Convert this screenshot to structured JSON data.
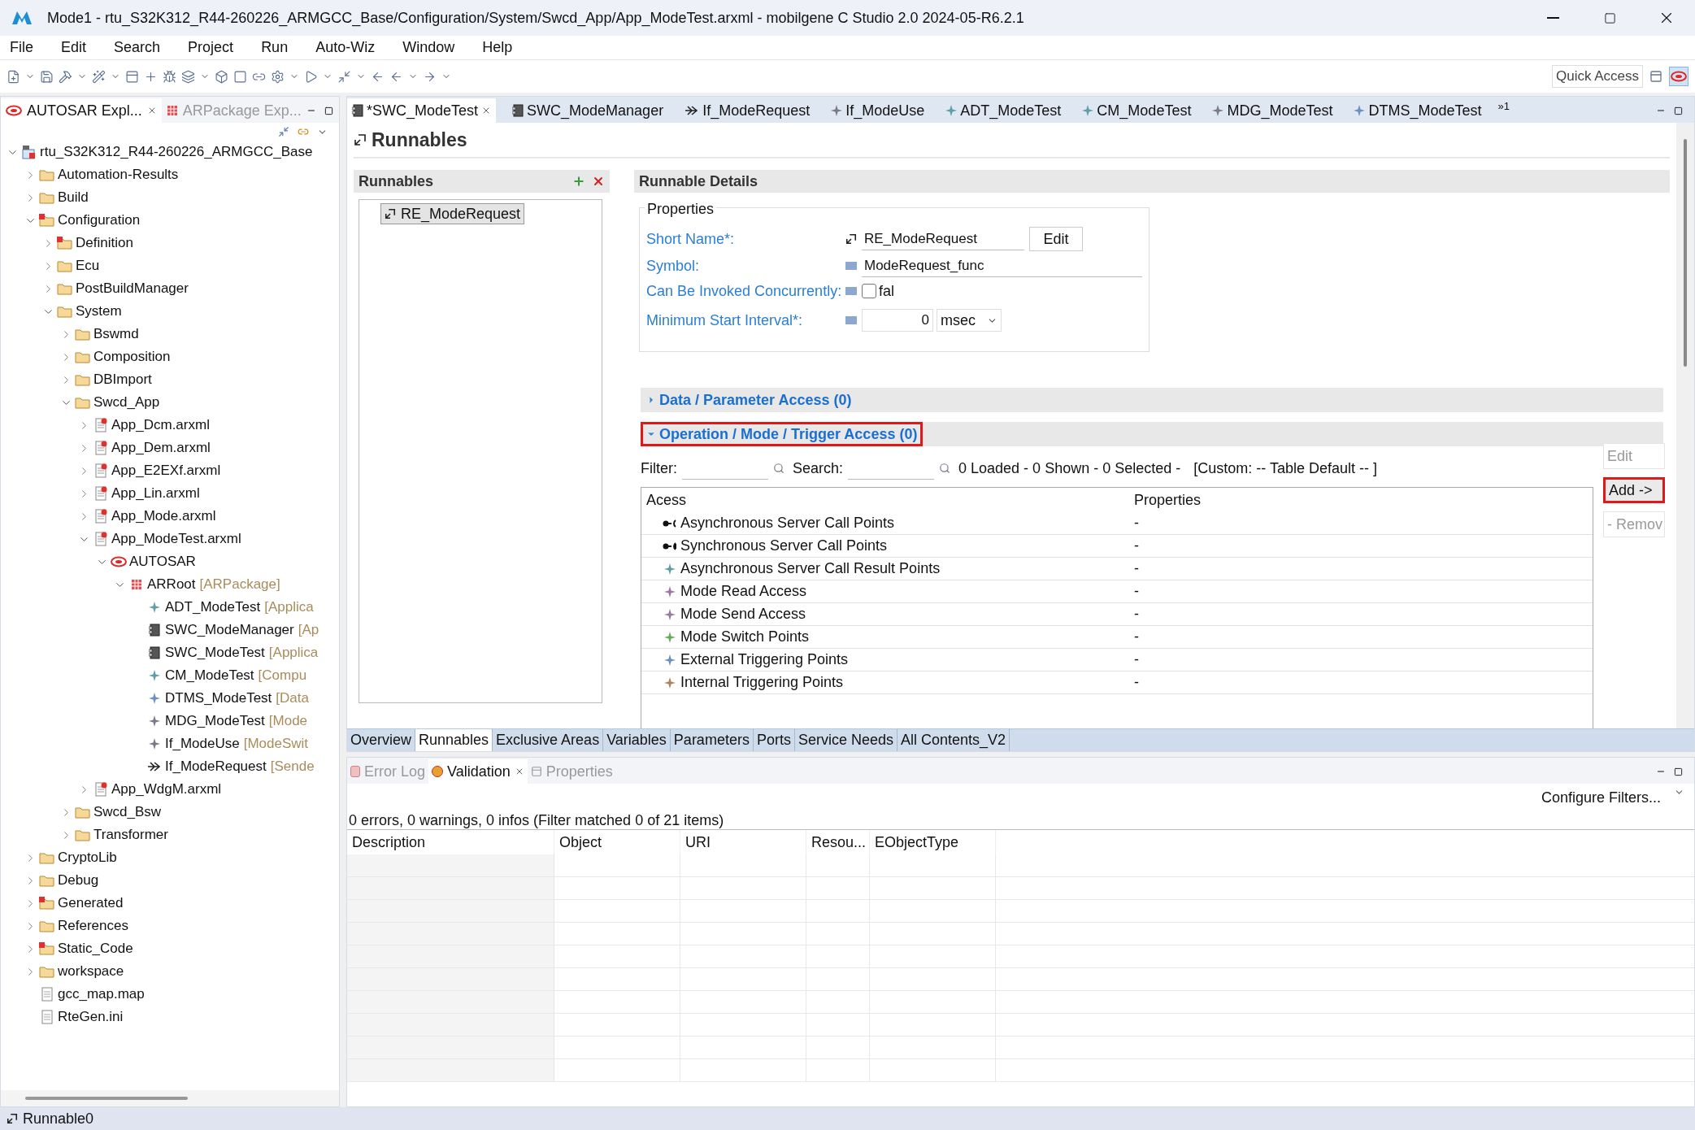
{
  "window": {
    "title": "Mode1 - rtu_S32K312_R44-260226_ARMGCC_Base/Configuration/System/Swcd_App/App_ModeTest.arxml - mobilgene C Studio 2.0 2024-05-R6.2.1"
  },
  "menu": [
    "File",
    "Edit",
    "Search",
    "Project",
    "Run",
    "Auto-Wiz",
    "Window",
    "Help"
  ],
  "quick_access": {
    "placeholder": "Quick Access"
  },
  "left_tabs": [
    {
      "label": "AUTOSAR Expl...",
      "selected": true
    },
    {
      "label": "ARPackage Exp...",
      "selected": false
    }
  ],
  "tree": [
    {
      "label": "rtu_S32K312_R44-260226_ARMGCC_Base",
      "kind": "project",
      "expanded": true,
      "children": [
        {
          "label": "Automation-Results",
          "kind": "folder",
          "expanded": false
        },
        {
          "label": "Build",
          "kind": "folder",
          "expanded": false
        },
        {
          "label": "Configuration",
          "kind": "errorfolder",
          "expanded": true,
          "children": [
            {
              "label": "Definition",
              "kind": "errorfolder",
              "expanded": false
            },
            {
              "label": "Ecu",
              "kind": "folder",
              "expanded": false
            },
            {
              "label": "PostBuildManager",
              "kind": "folder",
              "expanded": false
            },
            {
              "label": "System",
              "kind": "folder",
              "expanded": true,
              "children": [
                {
                  "label": "Bswmd",
                  "kind": "folder",
                  "expanded": false
                },
                {
                  "label": "Composition",
                  "kind": "folder",
                  "expanded": false
                },
                {
                  "label": "DBImport",
                  "kind": "folder",
                  "expanded": false
                },
                {
                  "label": "Swcd_App",
                  "kind": "folder",
                  "expanded": true,
                  "children": [
                    {
                      "label": "App_Dcm.arxml",
                      "kind": "file",
                      "expanded": false
                    },
                    {
                      "label": "App_Dem.arxml",
                      "kind": "file",
                      "expanded": false
                    },
                    {
                      "label": "App_E2EXf.arxml",
                      "kind": "file",
                      "expanded": false
                    },
                    {
                      "label": "App_Lin.arxml",
                      "kind": "file",
                      "expanded": false
                    },
                    {
                      "label": "App_Mode.arxml",
                      "kind": "file",
                      "expanded": false
                    },
                    {
                      "label": "App_ModeTest.arxml",
                      "kind": "file",
                      "expanded": true,
                      "children": [
                        {
                          "label": "AUTOSAR",
                          "kind": "autosar",
                          "expanded": true,
                          "children": [
                            {
                              "label": "ARRoot",
                              "suffix": "[ARPackage]",
                              "kind": "package",
                              "expanded": true,
                              "children": [
                                {
                                  "label": "ADT_ModeTest",
                                  "suffix": "[Applica",
                                  "kind": "teal"
                                },
                                {
                                  "label": "SWC_ModeManager",
                                  "suffix": "[Ap",
                                  "kind": "component"
                                },
                                {
                                  "label": "SWC_ModeTest",
                                  "suffix": "[Applica",
                                  "kind": "component"
                                },
                                {
                                  "label": "CM_ModeTest",
                                  "suffix": "[Compu",
                                  "kind": "teal"
                                },
                                {
                                  "label": "DTMS_ModeTest",
                                  "suffix": "[Data",
                                  "kind": "blue"
                                },
                                {
                                  "label": "MDG_ModeTest",
                                  "suffix": "[Mode",
                                  "kind": "gray"
                                },
                                {
                                  "label": "If_ModeUse",
                                  "suffix": "[ModeSwit",
                                  "kind": "gray"
                                },
                                {
                                  "label": "If_ModeRequest",
                                  "suffix": "[Sende",
                                  "kind": "interface"
                                }
                              ]
                            }
                          ]
                        }
                      ]
                    },
                    {
                      "label": "App_WdgM.arxml",
                      "kind": "file",
                      "expanded": false
                    }
                  ]
                },
                {
                  "label": "Swcd_Bsw",
                  "kind": "folder",
                  "expanded": false
                },
                {
                  "label": "Transformer",
                  "kind": "folder",
                  "expanded": false
                }
              ]
            }
          ]
        },
        {
          "label": "CryptoLib",
          "kind": "folder",
          "expanded": false
        },
        {
          "label": "Debug",
          "kind": "folder",
          "expanded": false
        },
        {
          "label": "Generated",
          "kind": "errorfolder",
          "expanded": false
        },
        {
          "label": "References",
          "kind": "folder",
          "expanded": false
        },
        {
          "label": "Static_Code",
          "kind": "errorfolder",
          "expanded": false
        },
        {
          "label": "workspace",
          "kind": "folder",
          "expanded": false
        },
        {
          "label": "gcc_map.map",
          "kind": "plainfile"
        },
        {
          "label": "RteGen.ini",
          "kind": "plainfile"
        }
      ]
    }
  ],
  "editor_tabs": [
    {
      "label": "*SWC_ModeTest",
      "kind": "component",
      "selected": true
    },
    {
      "label": "SWC_ModeManager",
      "kind": "component",
      "selected": false
    },
    {
      "label": "If_ModeRequest",
      "kind": "interface",
      "selected": false
    },
    {
      "label": "If_ModeUse",
      "kind": "gray",
      "selected": false
    },
    {
      "label": "ADT_ModeTest",
      "kind": "teal",
      "selected": false
    },
    {
      "label": "CM_ModeTest",
      "kind": "teal",
      "selected": false
    },
    {
      "label": "MDG_ModeTest",
      "kind": "gray",
      "selected": false
    },
    {
      "label": "DTMS_ModeTest",
      "kind": "blue",
      "selected": false
    }
  ],
  "more_tabs": "»1",
  "page_title": "Runnables",
  "runnables": {
    "title": "Runnables",
    "items": [
      {
        "label": "RE_ModeRequest",
        "selected": true
      }
    ]
  },
  "details": {
    "title": "Runnable Details",
    "group": "Properties",
    "short_name": {
      "label": "Short Name*:",
      "value": "RE_ModeRequest",
      "button": "Edit"
    },
    "symbol": {
      "label": "Symbol:",
      "value": "ModeRequest_func"
    },
    "concurrent": {
      "label": "Can Be Invoked Concurrently:",
      "checked": false,
      "value": "fal"
    },
    "interval": {
      "label": "Minimum Start Interval*:",
      "value": "0",
      "unit": "msec"
    }
  },
  "sections": [
    {
      "title": "Data / Parameter Access (0)",
      "expanded": false,
      "highlighted": false
    },
    {
      "title": "Operation / Mode / Trigger Access (0)",
      "expanded": true,
      "highlighted": true
    }
  ],
  "filter": {
    "label": "Filter:",
    "search_label": "Search:",
    "status": "0 Loaded - 0 Shown - 0 Selected -",
    "custom": "[Custom: -- Table Default -- ]"
  },
  "access_table": {
    "columns": [
      "Acess",
      "Properties"
    ],
    "rows": [
      {
        "label": "Asynchronous Server Call Points",
        "kind": "asynccall",
        "value": "-"
      },
      {
        "label": "Synchronous Server Call Points",
        "kind": "synccall",
        "value": "-"
      },
      {
        "label": "Asynchronous Server Call Result Points",
        "kind": "teal",
        "value": "-"
      },
      {
        "label": "Mode Read Access",
        "kind": "purple",
        "value": "-"
      },
      {
        "label": "Mode Send Access",
        "kind": "purple",
        "value": "-"
      },
      {
        "label": "Mode Switch Points",
        "kind": "green",
        "value": "-"
      },
      {
        "label": "External Triggering Points",
        "kind": "blue",
        "value": "-"
      },
      {
        "label": "Internal Triggering Points",
        "kind": "brown",
        "value": "-"
      }
    ]
  },
  "side_buttons": [
    {
      "label": "Edit",
      "disabled": true,
      "highlighted": false
    },
    {
      "label": "Add ->",
      "disabled": false,
      "highlighted": true
    },
    {
      "label": "- Remov",
      "disabled": true,
      "highlighted": false
    }
  ],
  "page_tabs": [
    {
      "label": "Overview",
      "selected": false
    },
    {
      "label": "Runnables",
      "selected": true
    },
    {
      "label": "Exclusive Areas",
      "selected": false
    },
    {
      "label": "Variables",
      "selected": false
    },
    {
      "label": "Parameters",
      "selected": false
    },
    {
      "label": "Ports",
      "selected": false
    },
    {
      "label": "Service Needs",
      "selected": false
    },
    {
      "label": "All Contents_V2",
      "selected": false
    }
  ],
  "bottom_tabs": [
    {
      "label": "Error Log",
      "selected": false
    },
    {
      "label": "Validation",
      "selected": true
    },
    {
      "label": "Properties",
      "selected": false
    }
  ],
  "validation": {
    "configure": "Configure Filters...",
    "summary": "0 errors, 0 warnings, 0 infos (Filter matched 0 of 21 items)",
    "columns": [
      "Description",
      "Object",
      "URI",
      "Resou...",
      "EObjectType"
    ]
  },
  "status_bar": "Runnable0"
}
